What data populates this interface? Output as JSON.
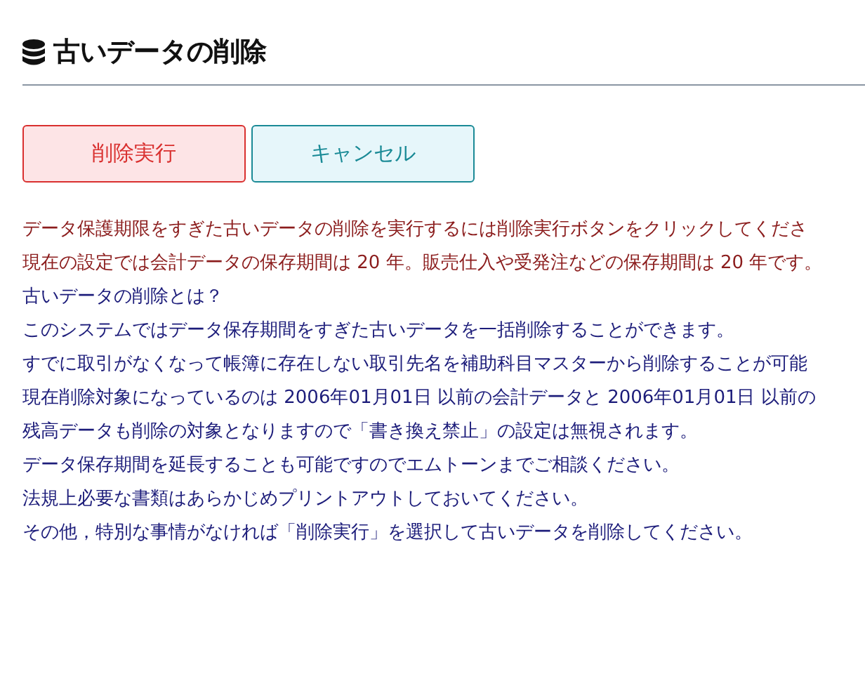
{
  "title": "古いデータの削除",
  "buttons": [
    {
      "label": "削除実行",
      "kind": "danger"
    },
    {
      "label": "キャンセル",
      "kind": "cancel"
    }
  ],
  "lines": [
    {
      "text": "データ保護期限をすぎた古いデータの削除を実行するには削除実行ボタンをクリックしてくださ",
      "kind": "warning"
    },
    {
      "text": "現在の設定では会計データの保存期間は 20 年。販売仕入や受発注などの保存期間は 20 年です。",
      "kind": "warning"
    },
    {
      "text": "古いデータの削除とは？",
      "kind": "info"
    },
    {
      "text": "このシステムではデータ保存期間をすぎた古いデータを一括削除することができます。",
      "kind": "info"
    },
    {
      "text": "すでに取引がなくなって帳簿に存在しない取引先名を補助科目マスターから削除することが可能",
      "kind": "info"
    },
    {
      "text": "現在削除対象になっているのは 2006年01月01日 以前の会計データと 2006年01月01日 以前の",
      "kind": "info"
    },
    {
      "text": "残高データも削除の対象となりますので「書き換え禁止」の設定は無視されます。",
      "kind": "info"
    },
    {
      "text": "データ保存期間を延長することも可能ですのでエムトーンまでご相談ください。",
      "kind": "info"
    },
    {
      "text": "法規上必要な書類はあらかじめプリントアウトしておいてください。",
      "kind": "info"
    },
    {
      "text": "その他，特別な事情がなければ「削除実行」を選択して古いデータを削除してください。",
      "kind": "info"
    }
  ]
}
